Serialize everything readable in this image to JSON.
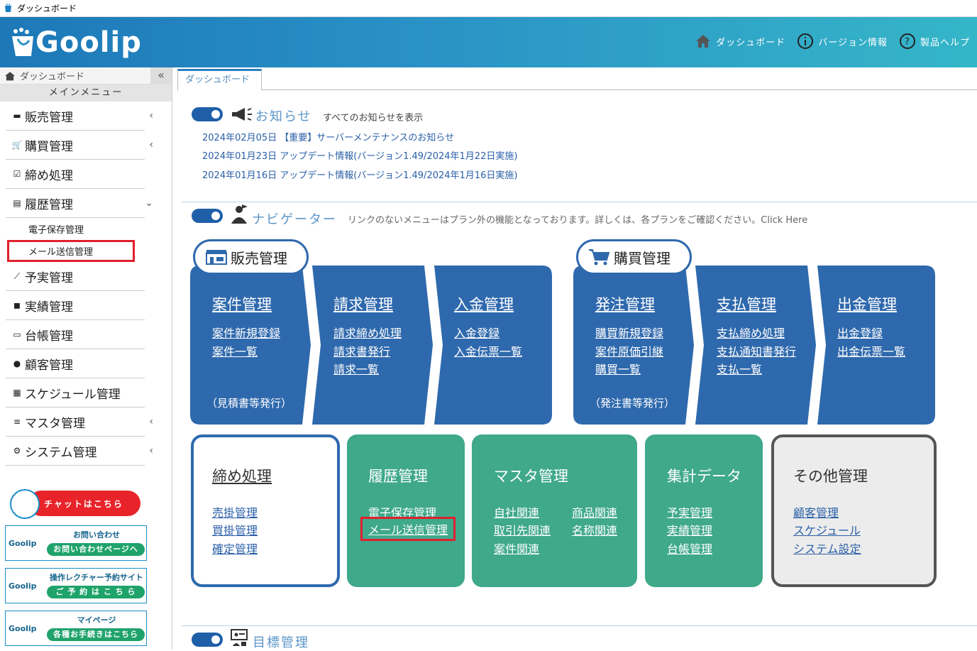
{
  "window": {
    "title": "ダッシュボード"
  },
  "header": {
    "logo": "Goolip",
    "nav": [
      "ダッシュボード",
      "バージョン情報",
      "製品ヘルプ"
    ]
  },
  "sidebar": {
    "breadcrumb": "ダッシュボード",
    "collapse": "«",
    "main_menu": "メインメニュー",
    "items": [
      "販売管理",
      "購買管理",
      "締め処理",
      "履歴管理",
      "予実管理",
      "実績管理",
      "台帳管理",
      "顧客管理",
      "スケジュール管理",
      "マスタ管理",
      "システム管理"
    ],
    "subitems": [
      "電子保存管理",
      "メール送信管理"
    ],
    "chat": "チャットはこちら",
    "banners": [
      {
        "logo": "Goolip",
        "title": "お問い合わせ",
        "button": "お問い合わせページへ"
      },
      {
        "logo": "Goolip",
        "title": "操作レクチャー予約サイト",
        "button": "ご 予 約 は こ ち ら"
      },
      {
        "logo": "Goolip",
        "title": "マイページ",
        "button": "各種お手続きはこちら"
      }
    ]
  },
  "tabs": [
    "ダッシュボード"
  ],
  "notice": {
    "title": "お知らせ",
    "show_all": "すべてのお知らせを表示",
    "items": [
      "2024年02月05日 【重要】サーバーメンテナンスのお知らせ",
      "2024年01月23日 アップデート情報(バージョン1.49/2024年1月22日実施)",
      "2024年01月16日 アップデート情報(バージョン1.49/2024年1月16日実施)"
    ]
  },
  "navigator": {
    "title": "ナビゲーター",
    "note": "リンクのないメニューはプラン外の機能となっております。詳しくは、各プランをご確認ください。Click Here",
    "sales": {
      "label": "販売管理",
      "cols": [
        {
          "title": "案件管理",
          "links": [
            "案件新規登録",
            "案件一覧"
          ],
          "note": "（見積書等発行）"
        },
        {
          "title": "請求管理",
          "links": [
            "請求締め処理",
            "請求書発行",
            "請求一覧"
          ]
        },
        {
          "title": "入金管理",
          "links": [
            "入金登録",
            "入金伝票一覧"
          ]
        }
      ]
    },
    "purchase": {
      "label": "購買管理",
      "cols": [
        {
          "title": "発注管理",
          "links": [
            "購買新規登録",
            "案件原価引継",
            "購買一覧"
          ],
          "note": "（発注書等発行）"
        },
        {
          "title": "支払管理",
          "links": [
            "支払締め処理",
            "支払通知書発行",
            "支払一覧"
          ]
        },
        {
          "title": "出金管理",
          "links": [
            "出金登録",
            "出金伝票一覧"
          ]
        }
      ]
    },
    "closing": {
      "title": "締め処理",
      "links": [
        "売掛管理",
        "買掛管理",
        "確定管理"
      ]
    },
    "history": {
      "title": "履歴管理",
      "links": [
        "電子保存管理",
        "メール送信管理"
      ]
    },
    "master": {
      "title": "マスタ管理",
      "links": [
        "自社関連",
        "取引先関連",
        "案件関連",
        "商品関連",
        "名称関連"
      ]
    },
    "aggregate": {
      "title": "集計データ",
      "links": [
        "予実管理",
        "実績管理",
        "台帳管理"
      ]
    },
    "other": {
      "title": "その他管理",
      "links": [
        "顧客管理",
        "スケジュール",
        "システム設定"
      ]
    }
  },
  "goals": {
    "title": "目標管理"
  }
}
